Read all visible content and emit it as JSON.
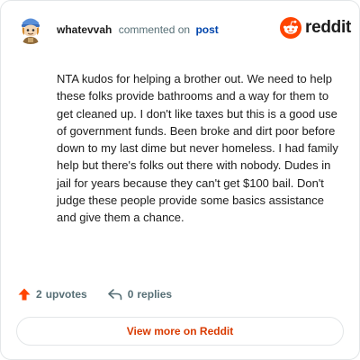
{
  "header": {
    "username": "whatevvah",
    "action": "commented on",
    "post_link": "post"
  },
  "brand": {
    "wordmark": "reddit",
    "color": "#ff4500"
  },
  "avatar": {
    "icon": "snoo-avatar-icon"
  },
  "comment": {
    "body": "NTA kudos for helping a brother out. We need to help these folks provide bathrooms and a way for them to get cleaned up. I don't like taxes but this is a good use of government funds. Been broke and dirt poor before down to my last dime but never homeless. I had family help but there's folks out there with nobody. Dudes in jail for years because they can't get $100 bail. Don't judge these people provide some basics assistance and give them a chance."
  },
  "actions": {
    "upvotes": {
      "count": "2",
      "label": "upvotes",
      "icon": "upvote-arrow-icon",
      "color": "#ff4500"
    },
    "replies": {
      "count": "0",
      "label": "replies",
      "icon": "reply-icon"
    }
  },
  "footer": {
    "view_more": "View more on Reddit",
    "color": "#d93a00"
  }
}
